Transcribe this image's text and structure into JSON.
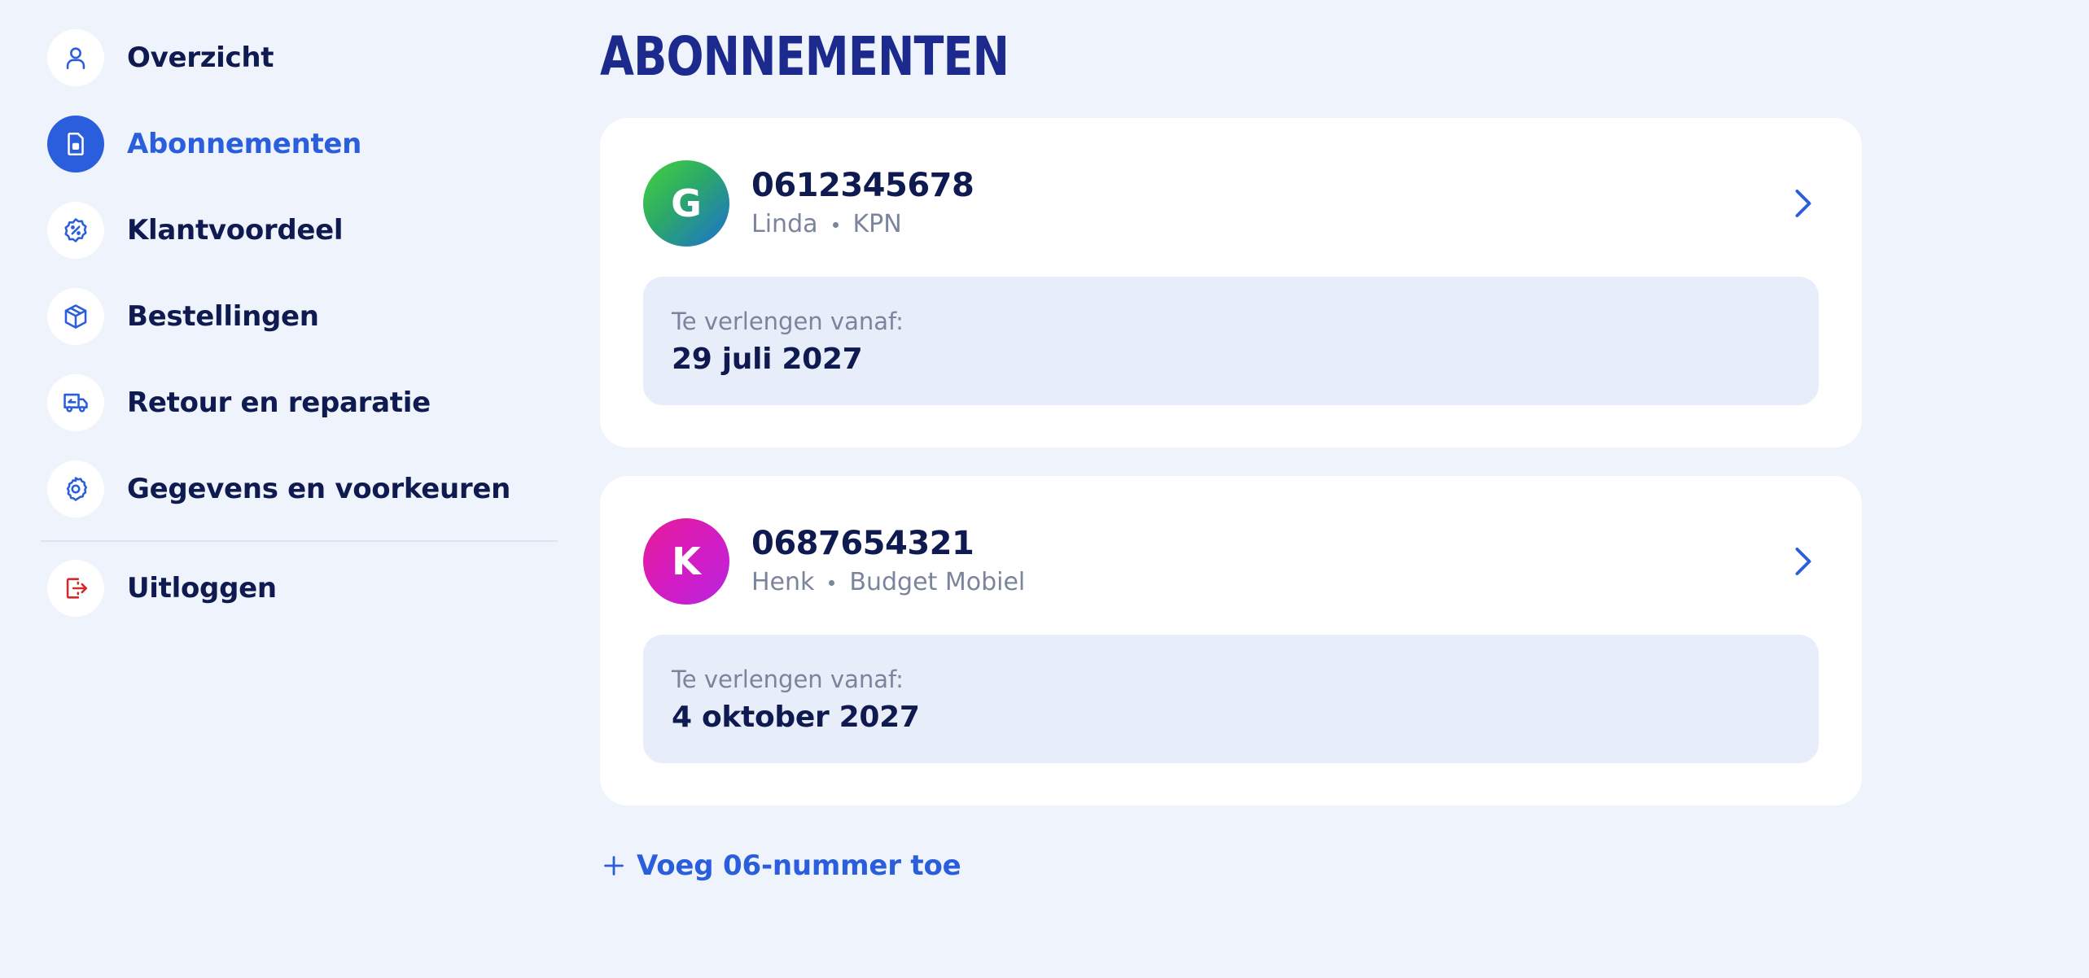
{
  "sidebar": {
    "items": [
      {
        "label": "Overzicht",
        "icon": "user-icon"
      },
      {
        "label": "Abonnementen",
        "icon": "sim-card-icon",
        "active": true
      },
      {
        "label": "Klantvoordeel",
        "icon": "discount-badge-icon"
      },
      {
        "label": "Bestellingen",
        "icon": "package-icon"
      },
      {
        "label": "Retour en reparatie",
        "icon": "return-truck-icon"
      },
      {
        "label": "Gegevens en voorkeuren",
        "icon": "gear-icon"
      }
    ],
    "logout": {
      "label": "Uitloggen",
      "icon": "logout-icon"
    }
  },
  "main": {
    "title": "ABONNEMENTEN",
    "subscriptions": [
      {
        "initial": "G",
        "number": "0612345678",
        "name": "Linda",
        "provider": "KPN",
        "renewal_label": "Te verlengen vanaf:",
        "renewal_date": "29 juli 2027"
      },
      {
        "initial": "K",
        "number": "0687654321",
        "name": "Henk",
        "provider": "Budget Mobiel",
        "renewal_label": "Te verlengen vanaf:",
        "renewal_date": "4 oktober 2027"
      }
    ],
    "add_number": "Voeg 06-nummer toe"
  },
  "colors": {
    "background": "#EEF3FC",
    "accent": "#2A5EDC",
    "title": "#1B2A8C",
    "text": "#0F1A50",
    "muted": "#7A849C",
    "logout": "#D42A2A"
  }
}
